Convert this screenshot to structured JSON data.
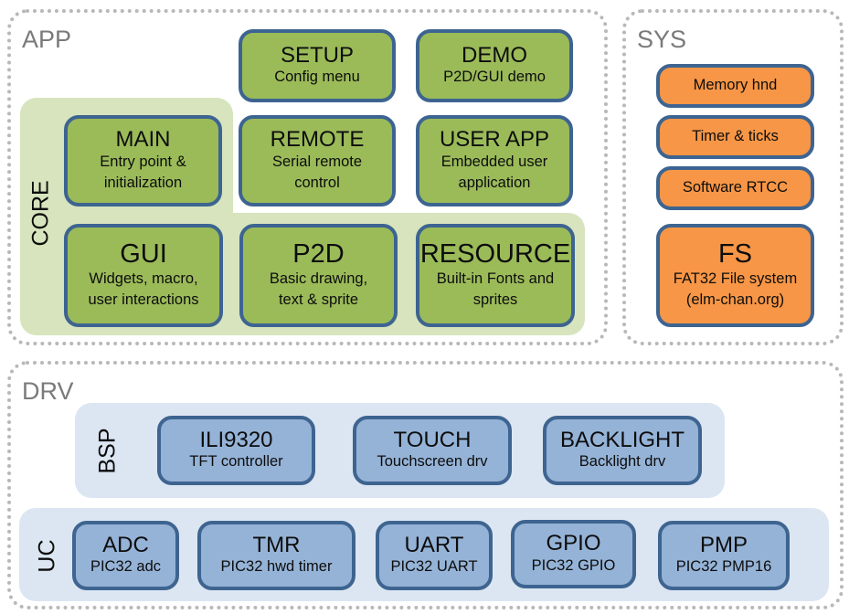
{
  "sections": {
    "app": {
      "label": "APP"
    },
    "sys": {
      "label": "SYS"
    },
    "drv": {
      "label": "DRV"
    },
    "core": {
      "label": "CORE"
    },
    "bsp": {
      "label": "BSP"
    },
    "uc": {
      "label": "UC"
    }
  },
  "app": {
    "setup": {
      "title": "SETUP",
      "sub": "Config menu"
    },
    "demo": {
      "title": "DEMO",
      "sub": "P2D/GUI demo"
    },
    "main": {
      "title": "MAIN",
      "sub1": "Entry point &",
      "sub2": "initialization"
    },
    "remote": {
      "title": "REMOTE",
      "sub1": "Serial remote",
      "sub2": "control"
    },
    "user_app": {
      "title": "USER APP",
      "sub1": "Embedded user",
      "sub2": "application"
    },
    "gui": {
      "title": "GUI",
      "sub1": "Widgets, macro,",
      "sub2": "user interactions"
    },
    "p2d": {
      "title": "P2D",
      "sub1": "Basic drawing,",
      "sub2": "text & sprite"
    },
    "resource": {
      "title": "RESOURCE",
      "sub1": "Built-in Fonts and",
      "sub2": "sprites"
    }
  },
  "sys": {
    "memory": {
      "label": "Memory hnd"
    },
    "timer": {
      "label": "Timer & ticks"
    },
    "rtcc": {
      "label": "Software RTCC"
    },
    "fs": {
      "title": "FS",
      "sub1": "FAT32 File system",
      "sub2": "(elm-chan.org)"
    }
  },
  "bsp": {
    "ili9320": {
      "title": "ILI9320",
      "sub": "TFT controller"
    },
    "touch": {
      "title": "TOUCH",
      "sub": "Touchscreen drv"
    },
    "backlight": {
      "title": "BACKLIGHT",
      "sub": "Backlight drv"
    }
  },
  "uc": {
    "adc": {
      "title": "ADC",
      "sub": "PIC32 adc"
    },
    "tmr": {
      "title": "TMR",
      "sub": "PIC32 hwd timer"
    },
    "uart": {
      "title": "UART",
      "sub": "PIC32 UART"
    },
    "gpio": {
      "title": "GPIO",
      "sub": "PIC32 GPIO"
    },
    "pmp": {
      "title": "PMP",
      "sub": "PIC32 PMP16"
    }
  },
  "colors": {
    "app_box": "#9bbb59",
    "core_region": "#d7e4bd",
    "sys_box": "#f79646",
    "drv_box": "#95b3d7",
    "drv_region": "#dce6f2",
    "box_border": "#3d6491",
    "section_border": "#b8b8b8",
    "section_label": "#7a7a7a"
  }
}
